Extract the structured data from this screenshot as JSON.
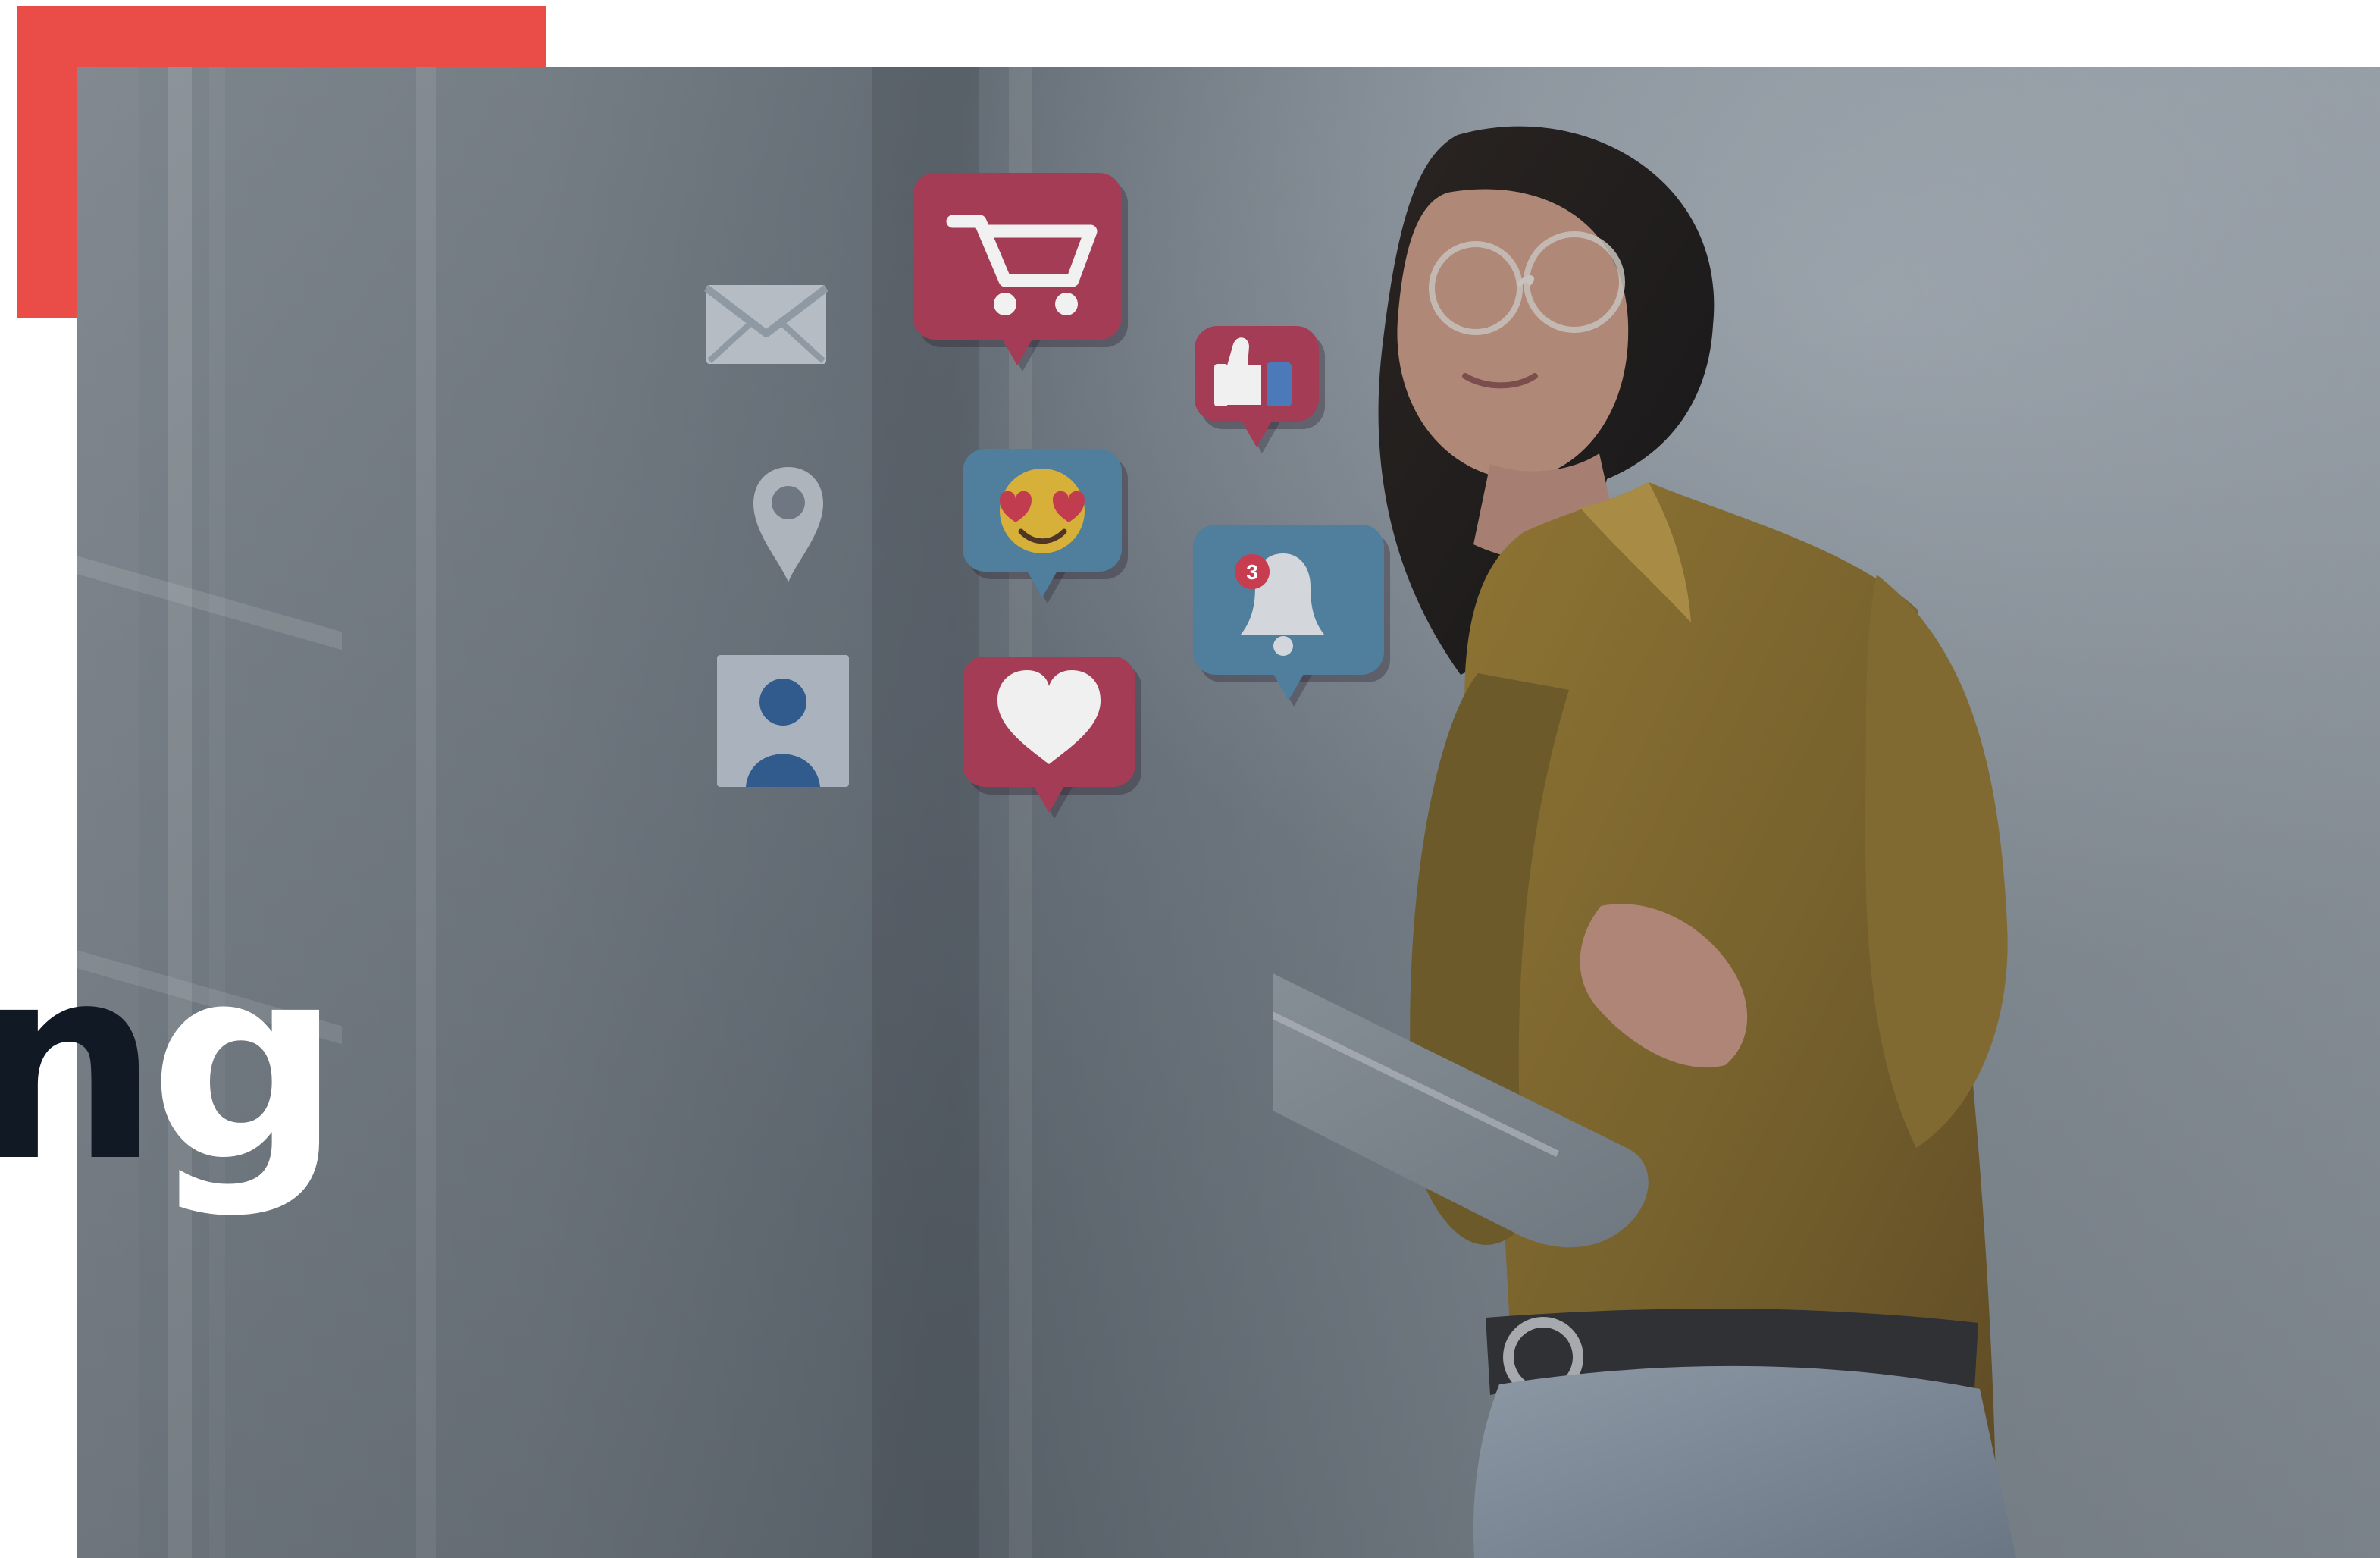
{
  "scene": {
    "headline_fragment": "ng",
    "notification_count": "3"
  },
  "icons": [
    "envelope-icon",
    "shopping-cart-icon",
    "thumbs-up-icon",
    "location-pin-icon",
    "heart-eyes-emoji-icon",
    "notification-bell-icon",
    "profile-icon",
    "heart-icon"
  ],
  "colors": {
    "accent": "#ea4d48",
    "headline_dark": "#111a24",
    "headline_light": "#ffffff",
    "social_red": "#a53c55",
    "social_blue": "#4f7f9d",
    "photo_overlay": "#687179"
  }
}
